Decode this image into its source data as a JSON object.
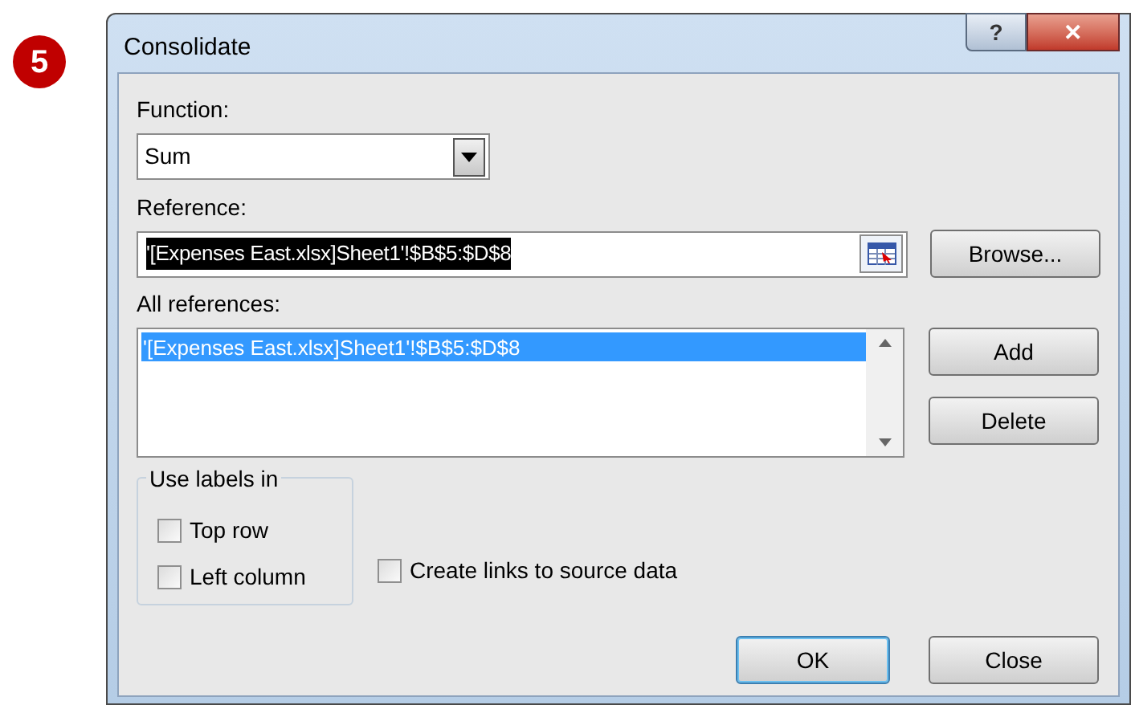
{
  "step_badge": "5",
  "window": {
    "title": "Consolidate",
    "help_button": "?",
    "close_button": "✕"
  },
  "function": {
    "label": "Function:",
    "value": "Sum"
  },
  "reference": {
    "label": "Reference:",
    "value": "'[Expenses East.xlsx]Sheet1'!$B$5:$D$8",
    "selected": true
  },
  "browse_button": "Browse...",
  "all_references": {
    "label": "All references:",
    "items": [
      {
        "text": "'[Expenses East.xlsx]Sheet1'!$B$5:$D$8",
        "selected": true
      }
    ]
  },
  "add_button": "Add",
  "delete_button": "Delete",
  "use_labels": {
    "title": "Use labels in",
    "options": [
      {
        "label": "Top row",
        "checked": false
      },
      {
        "label": "Left column",
        "checked": false
      }
    ]
  },
  "create_links": {
    "label": "Create links to source data",
    "checked": false
  },
  "buttons": [
    {
      "label": "OK",
      "default": true
    },
    {
      "label": "Close",
      "default": false
    }
  ]
}
